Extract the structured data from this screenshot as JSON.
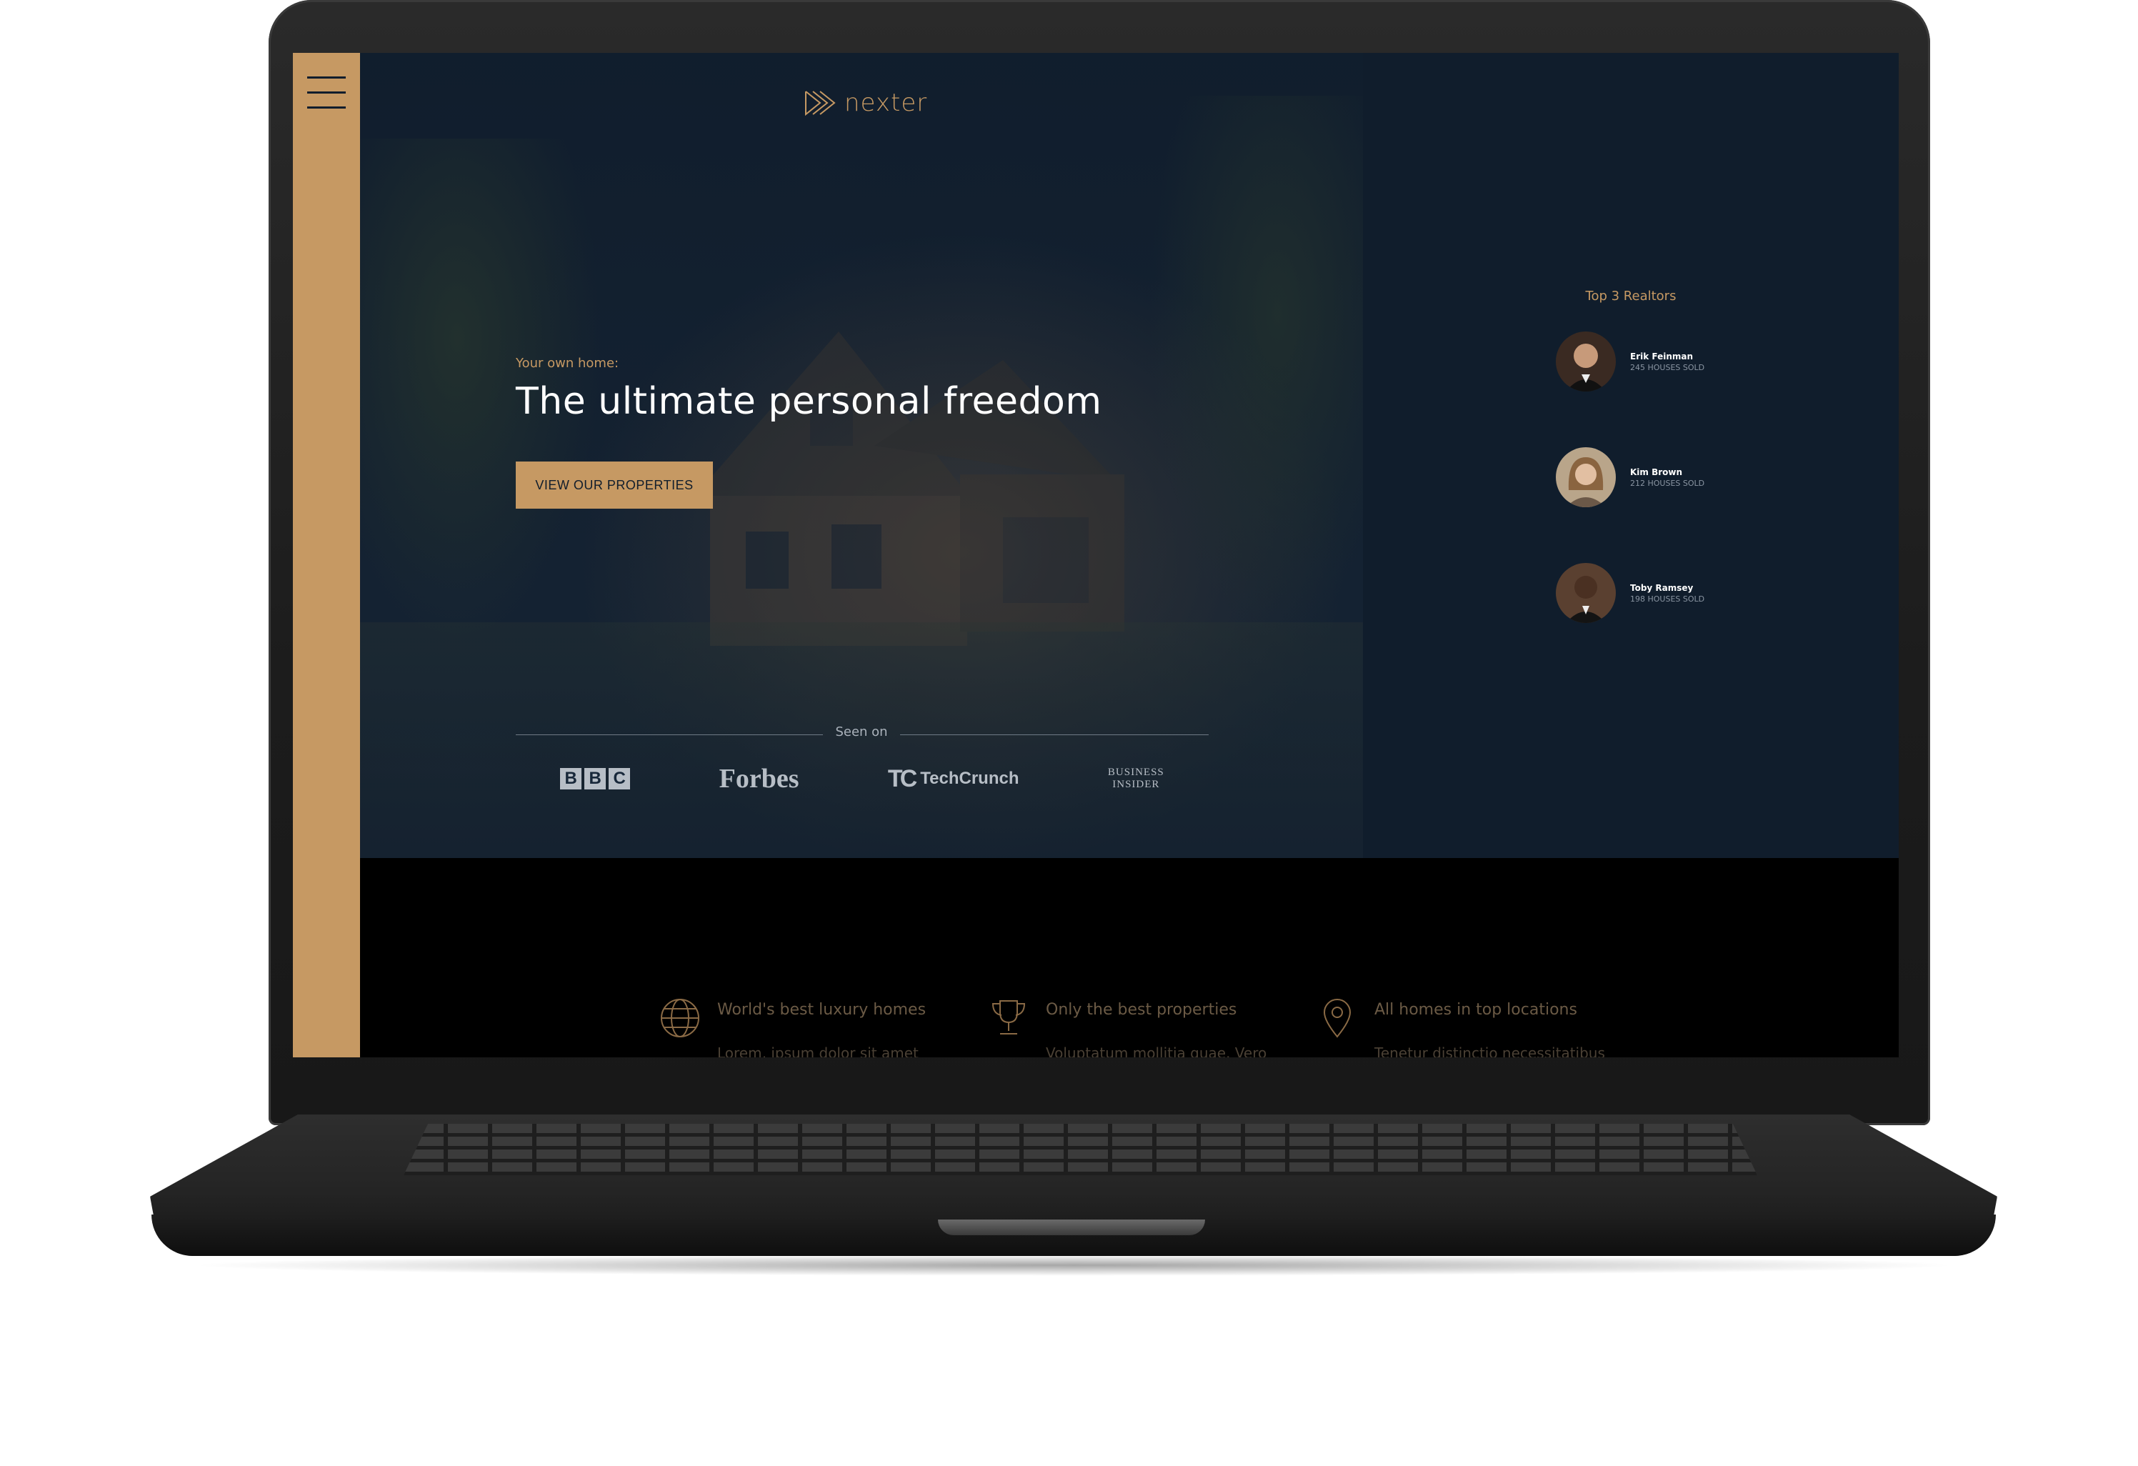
{
  "site": {
    "brand": "nexter",
    "accent_color": "#c69963",
    "dark_color": "#101d2c"
  },
  "sidebar": {
    "menu_icon": "hamburger-menu-icon"
  },
  "hero": {
    "subtitle": "Your own home:",
    "title": "The ultimate personal freedom",
    "cta_label": "VIEW OUR PROPERTIES",
    "seen_on_label": "Seen on",
    "press_logos": [
      "BBC",
      "Forbes",
      "TechCrunch",
      "Business Insider"
    ]
  },
  "realtors": {
    "title": "Top 3 Realtors",
    "items": [
      {
        "name": "Erik Feinman",
        "sold": "245 HOUSES SOLD"
      },
      {
        "name": "Kim Brown",
        "sold": "212 HOUSES SOLD"
      },
      {
        "name": "Toby Ramsey",
        "sold": "198 HOUSES SOLD"
      }
    ]
  },
  "features": [
    {
      "icon": "globe-icon",
      "title": "World's best luxury homes",
      "text": "Lorem, ipsum dolor sit amet"
    },
    {
      "icon": "trophy-icon",
      "title": "Only the best properties",
      "text": "Voluptatum mollitia quae. Vero"
    },
    {
      "icon": "map-pin-icon",
      "title": "All homes in top locations",
      "text": "Tenetur distinctio necessitatibus"
    }
  ]
}
